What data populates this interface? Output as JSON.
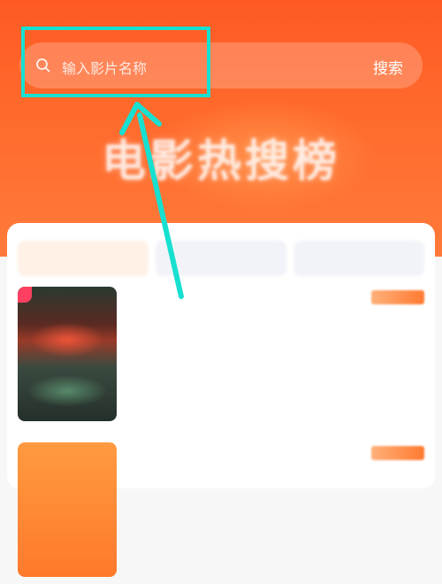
{
  "status_bar": {
    "time": "",
    "icons": ""
  },
  "search": {
    "placeholder": "输入影片名称",
    "button_label": "搜索",
    "icon": "search-icon"
  },
  "hero": {
    "title": "电影热搜榜",
    "subtitle": ""
  },
  "tabs": [
    {
      "label": "",
      "active": true
    },
    {
      "label": "",
      "active": false
    },
    {
      "label": "",
      "active": false
    }
  ],
  "movies": [
    {
      "name": "",
      "lines": [
        "",
        "",
        "",
        "",
        ""
      ],
      "hot": ""
    },
    {
      "name": "",
      "lines": [],
      "hot": ""
    }
  ],
  "colors": {
    "brand": "#ff5a24",
    "highlight": "#17e0d0",
    "accent": "#ff7a30"
  }
}
